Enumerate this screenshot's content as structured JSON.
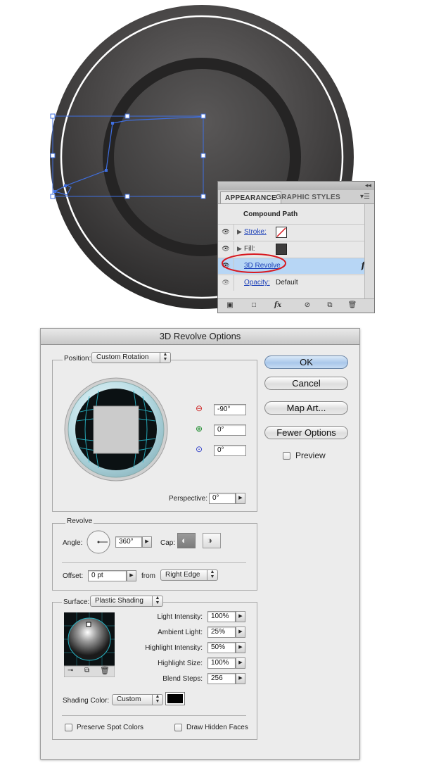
{
  "appearance_panel": {
    "tabs": [
      "APPEARANCE",
      "GRAPHIC STYLES"
    ],
    "title": "Compound Path",
    "rows": [
      {
        "label": "Stroke:",
        "value": "",
        "kind": "link"
      },
      {
        "label": "Fill:",
        "value": "",
        "kind": "plain"
      },
      {
        "label": "3D Revolve",
        "value": "",
        "kind": "link",
        "selected": true
      },
      {
        "label": "Opacity:",
        "value": "Default",
        "kind": "link"
      }
    ],
    "fx_symbol": "fx",
    "bottom_icons": [
      "new-art-basic-icon",
      "clear-appearance-icon",
      "fx-menu-icon",
      "no-symbol-icon",
      "duplicate-item-icon",
      "trash-icon"
    ]
  },
  "dialog": {
    "title": "3D Revolve Options",
    "position": {
      "label": "Position:",
      "value": "Custom Rotation",
      "x_rotation": "-90°",
      "y_rotation": "0°",
      "z_rotation": "0°",
      "perspective_label": "Perspective:",
      "perspective_value": "0°"
    },
    "revolve": {
      "group_label": "Revolve",
      "angle_label": "Angle:",
      "angle_value": "360°",
      "cap_label": "Cap:",
      "offset_label": "Offset:",
      "offset_value": "0 pt",
      "from_label": "from",
      "from_value": "Right Edge"
    },
    "surface": {
      "label": "Surface:",
      "value": "Plastic Shading",
      "light_intensity_label": "Light Intensity:",
      "light_intensity": "100%",
      "ambient_light_label": "Ambient Light:",
      "ambient_light": "25%",
      "highlight_intensity_label": "Highlight Intensity:",
      "highlight_intensity": "50%",
      "highlight_size_label": "Highlight Size:",
      "highlight_size": "100%",
      "blend_steps_label": "Blend Steps:",
      "blend_steps": "256",
      "shading_color_label": "Shading Color:",
      "shading_color_value": "Custom",
      "shading_color_swatch": "#000000"
    },
    "checkboxes": {
      "preserve_spot_colors": "Preserve Spot Colors",
      "draw_hidden_faces": "Draw Hidden Faces",
      "preview": "Preview"
    },
    "buttons": {
      "ok": "OK",
      "cancel": "Cancel",
      "map_art": "Map Art...",
      "fewer_options": "Fewer Options"
    }
  },
  "colors": {
    "selection_blue": "#3f6fe0",
    "highlight_ellipse": "#d8181f",
    "selected_row": "#b7d6f5",
    "cube_cyan": "#27b3c4"
  }
}
